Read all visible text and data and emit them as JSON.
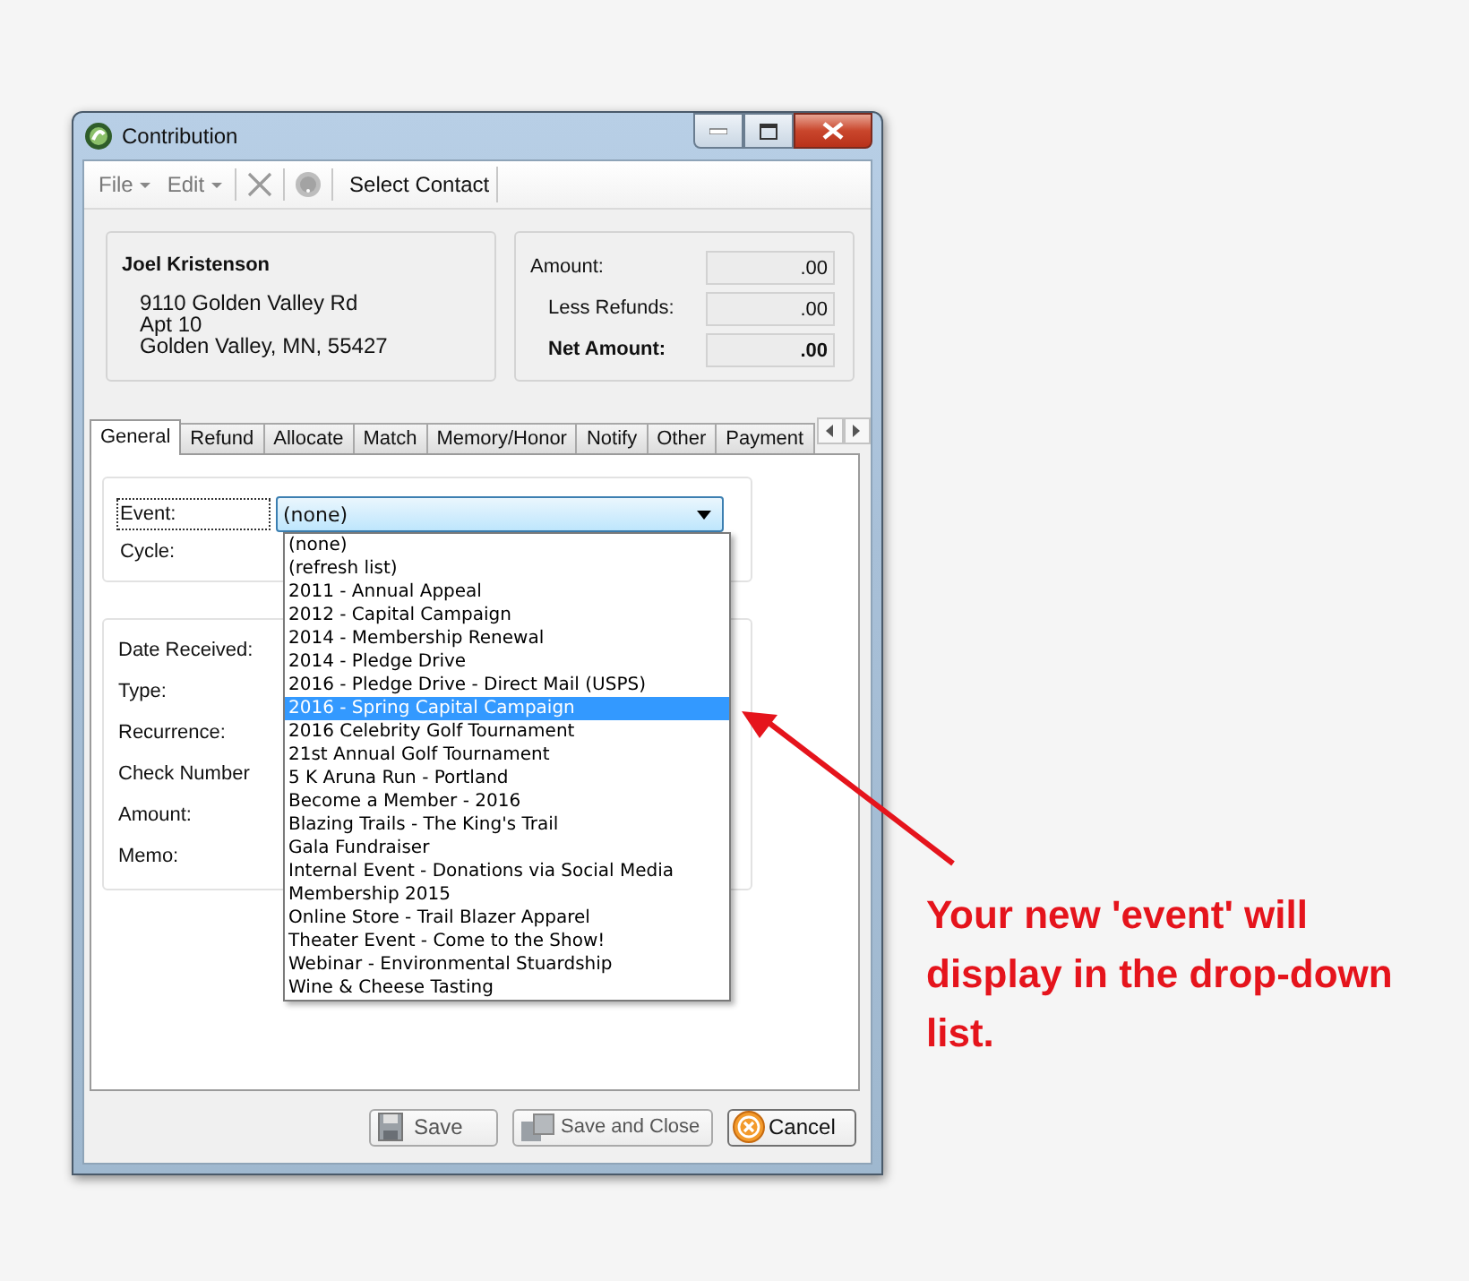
{
  "window": {
    "title": "Contribution"
  },
  "toolbar": [
    {
      "kind": "menu",
      "label": "File"
    },
    {
      "kind": "menu",
      "label": "Edit"
    },
    {
      "kind": "delete"
    },
    {
      "kind": "help"
    },
    {
      "kind": "button",
      "label": "Select Contact"
    }
  ],
  "contact": {
    "name": "Joel Kristenson",
    "address": [
      "9110 Golden Valley Rd",
      "Apt 10",
      "Golden Valley, MN, 55427"
    ]
  },
  "amounts": [
    {
      "kind": "plain",
      "label": "Amount:",
      "value": ".00"
    },
    {
      "kind": "sub",
      "label": "Less Refunds:",
      "value": ".00"
    },
    {
      "kind": "total",
      "label": "Net Amount:",
      "value": ".00"
    }
  ],
  "tabs": [
    {
      "label": "General",
      "selected": true
    },
    {
      "label": "Refund",
      "selected": false
    },
    {
      "label": "Allocate",
      "selected": false
    },
    {
      "label": "Match",
      "selected": false
    },
    {
      "label": "Memory/Honor",
      "selected": false
    },
    {
      "label": "Notify",
      "selected": false
    },
    {
      "label": "Other",
      "selected": false
    },
    {
      "label": "Payment",
      "selected": false
    }
  ],
  "event": {
    "label": "Event:",
    "focused": true,
    "value": "(none)",
    "expanded": true,
    "options": [
      {
        "label": "(none)",
        "highlighted": false
      },
      {
        "label": "(refresh list)",
        "highlighted": false
      },
      {
        "label": "2011 - Annual Appeal",
        "highlighted": false
      },
      {
        "label": "2012 - Capital Campaign",
        "highlighted": false
      },
      {
        "label": "2014 - Membership Renewal",
        "highlighted": false
      },
      {
        "label": "2014 - Pledge Drive",
        "highlighted": false
      },
      {
        "label": "2016 - Pledge Drive - Direct Mail (USPS)",
        "highlighted": false
      },
      {
        "label": "2016 - Spring Capital Campaign",
        "highlighted": true
      },
      {
        "label": "2016 Celebrity Golf Tournament",
        "highlighted": false
      },
      {
        "label": "21st Annual Golf Tournament",
        "highlighted": false
      },
      {
        "label": "5 K Aruna Run - Portland",
        "highlighted": false
      },
      {
        "label": "Become a Member - 2016",
        "highlighted": false
      },
      {
        "label": "Blazing Trails - The King's Trail",
        "highlighted": false
      },
      {
        "label": "Gala Fundraiser",
        "highlighted": false
      },
      {
        "label": "Internal Event - Donations via Social Media",
        "highlighted": false
      },
      {
        "label": "Membership 2015",
        "highlighted": false
      },
      {
        "label": "Online Store - Trail Blazer Apparel",
        "highlighted": false
      },
      {
        "label": "Theater Event - Come to the Show!",
        "highlighted": false
      },
      {
        "label": "Webinar - Environmental Stuardship",
        "highlighted": false
      },
      {
        "label": "Wine & Cheese Tasting",
        "highlighted": false
      }
    ]
  },
  "cycle_label": "Cycle:",
  "detail_labels": [
    "Date Received:",
    "Type:",
    "Recurrence:",
    "Check Number",
    "Amount:",
    "Memo:"
  ],
  "buttons": [
    {
      "kind": "save",
      "label": "Save",
      "disabled": true
    },
    {
      "kind": "save-close",
      "label": "Save and Close",
      "disabled": true
    },
    {
      "kind": "cancel",
      "label": "Cancel",
      "disabled": false
    }
  ],
  "annotation": "Your new 'event' will display in the drop-down list."
}
